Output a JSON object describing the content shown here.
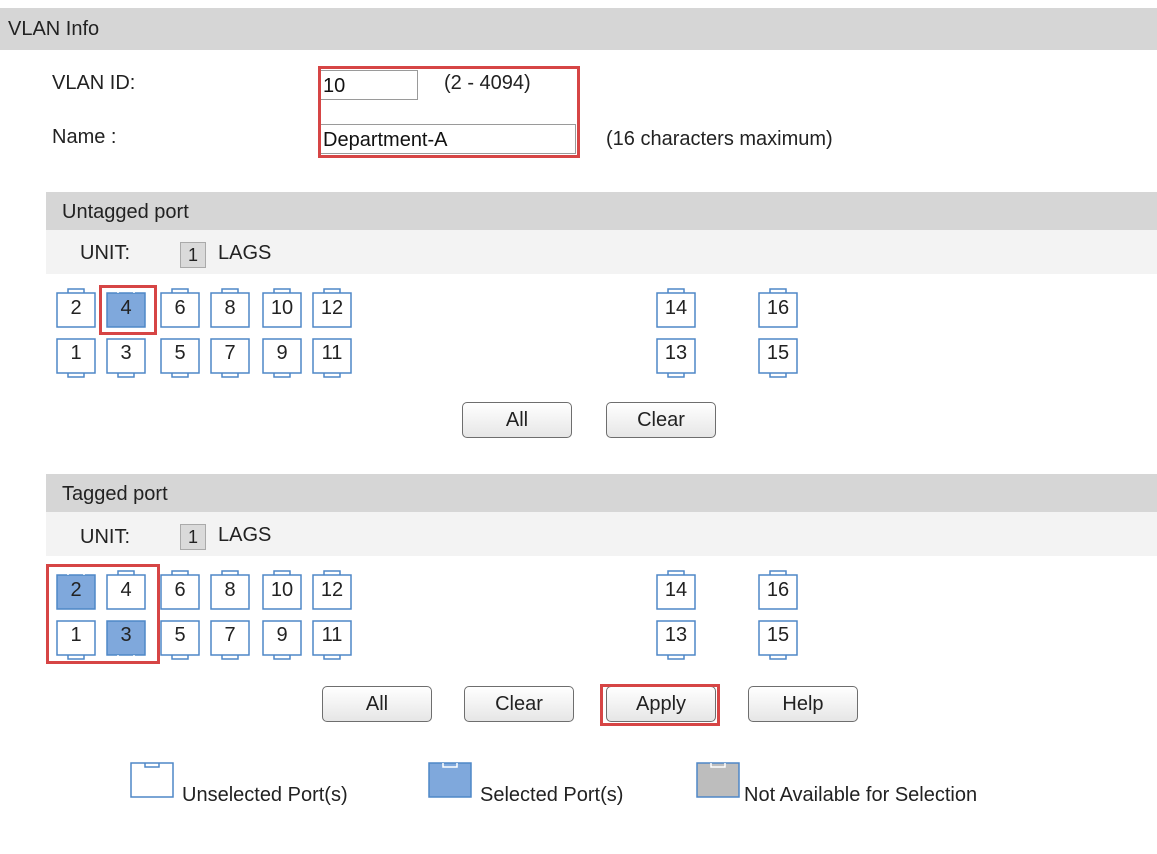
{
  "header": {
    "title": "VLAN Info"
  },
  "vlan": {
    "id_label": "VLAN ID:",
    "id_value": "10",
    "id_range": "(2 - 4094)",
    "name_label": "Name :",
    "name_value": "Department-A",
    "name_hint": "(16 characters maximum)"
  },
  "untagged": {
    "title": "Untagged port",
    "unit_label": "UNIT:",
    "unit_value": "1",
    "lags_label": "LAGS",
    "ports_top": [
      {
        "label": "2",
        "selected": false
      },
      {
        "label": "4",
        "selected": true
      },
      {
        "label": "6",
        "selected": false
      },
      {
        "label": "8",
        "selected": false
      },
      {
        "label": "10",
        "selected": false
      },
      {
        "label": "12",
        "selected": false
      },
      {
        "label": "14",
        "selected": false
      },
      {
        "label": "16",
        "selected": false
      }
    ],
    "ports_bottom": [
      {
        "label": "1",
        "selected": false
      },
      {
        "label": "3",
        "selected": false
      },
      {
        "label": "5",
        "selected": false
      },
      {
        "label": "7",
        "selected": false
      },
      {
        "label": "9",
        "selected": false
      },
      {
        "label": "11",
        "selected": false
      },
      {
        "label": "13",
        "selected": false
      },
      {
        "label": "15",
        "selected": false
      }
    ],
    "all_label": "All",
    "clear_label": "Clear"
  },
  "tagged": {
    "title": "Tagged port",
    "unit_label": "UNIT:",
    "unit_value": "1",
    "lags_label": "LAGS",
    "ports_top": [
      {
        "label": "2",
        "selected": true
      },
      {
        "label": "4",
        "selected": false
      },
      {
        "label": "6",
        "selected": false
      },
      {
        "label": "8",
        "selected": false
      },
      {
        "label": "10",
        "selected": false
      },
      {
        "label": "12",
        "selected": false
      },
      {
        "label": "14",
        "selected": false
      },
      {
        "label": "16",
        "selected": false
      }
    ],
    "ports_bottom": [
      {
        "label": "1",
        "selected": false
      },
      {
        "label": "3",
        "selected": true
      },
      {
        "label": "5",
        "selected": false
      },
      {
        "label": "7",
        "selected": false
      },
      {
        "label": "9",
        "selected": false
      },
      {
        "label": "11",
        "selected": false
      },
      {
        "label": "13",
        "selected": false
      },
      {
        "label": "15",
        "selected": false
      }
    ],
    "all_label": "All",
    "clear_label": "Clear",
    "apply_label": "Apply",
    "help_label": "Help"
  },
  "legend": {
    "unselected": "Unselected Port(s)",
    "selected": "Selected Port(s)",
    "unavailable": "Not Available for Selection"
  },
  "colors": {
    "selected_fill": "#7fa8dc",
    "port_outline": "#4f87c7",
    "unavailable_fill": "#bdbdbd",
    "highlight_red": "#d64545",
    "header_bg": "#d6d6d6"
  },
  "icons": {
    "port": "ethernet-port-icon"
  }
}
